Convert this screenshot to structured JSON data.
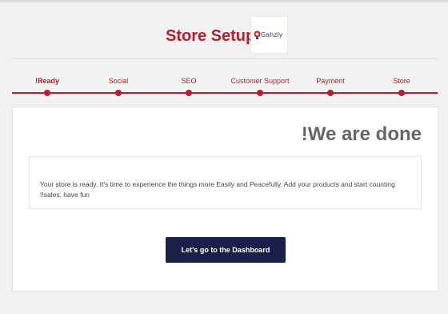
{
  "header": {
    "title": "Store Setup",
    "logo_text": "Gahzly"
  },
  "steps": [
    {
      "label": "!Ready",
      "active": true
    },
    {
      "label": "Social",
      "active": false
    },
    {
      "label": "SEO",
      "active": false
    },
    {
      "label": "Customer Support",
      "active": false
    },
    {
      "label": "Payment",
      "active": false
    },
    {
      "label": "Store",
      "active": false
    }
  ],
  "card": {
    "title": "!We are done",
    "message": "Your store is ready. It's time to experience the things more Easily and Peacefully. Add your products and start counting !!sales, have fun",
    "button_label": "Let's go to the Dashboard"
  },
  "colors": {
    "accent": "#b5202f",
    "button": "#1c1f4a",
    "title_gray": "#666666"
  }
}
